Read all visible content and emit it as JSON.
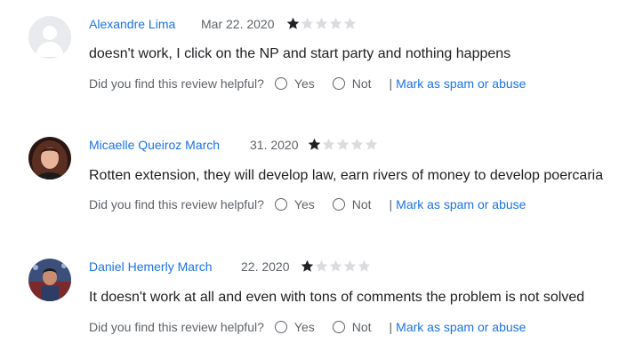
{
  "colors": {
    "link": "#1a73e8",
    "star_filled": "#202124",
    "star_empty": "#dadce0",
    "muted_text": "#5f6368",
    "body_text": "#202124"
  },
  "helpful_prompt": "Did you find this review helpful?",
  "yes_label": "Yes",
  "no_label": "Not",
  "separator": "|",
  "spam_label": "Mark as spam or abuse",
  "reviews": [
    {
      "author": "Alexandre Lima",
      "date": "Mar 22. 2020",
      "rating": 1,
      "max_rating": 5,
      "avatar": "default-avatar-icon",
      "text": "doesn't work, I click on the NP and start party and nothing happens"
    },
    {
      "author": "Micaelle Queiroz March",
      "date": "31. 2020",
      "rating": 1,
      "max_rating": 5,
      "avatar": "user-photo",
      "text": "Rotten extension, they will develop law, earn rivers of money to develop poercaria"
    },
    {
      "author": "Daniel Hemerly March",
      "date": "22. 2020",
      "rating": 1,
      "max_rating": 5,
      "avatar": "user-photo",
      "text": "It doesn't work at all and even with tons of comments the problem is not solved"
    }
  ]
}
